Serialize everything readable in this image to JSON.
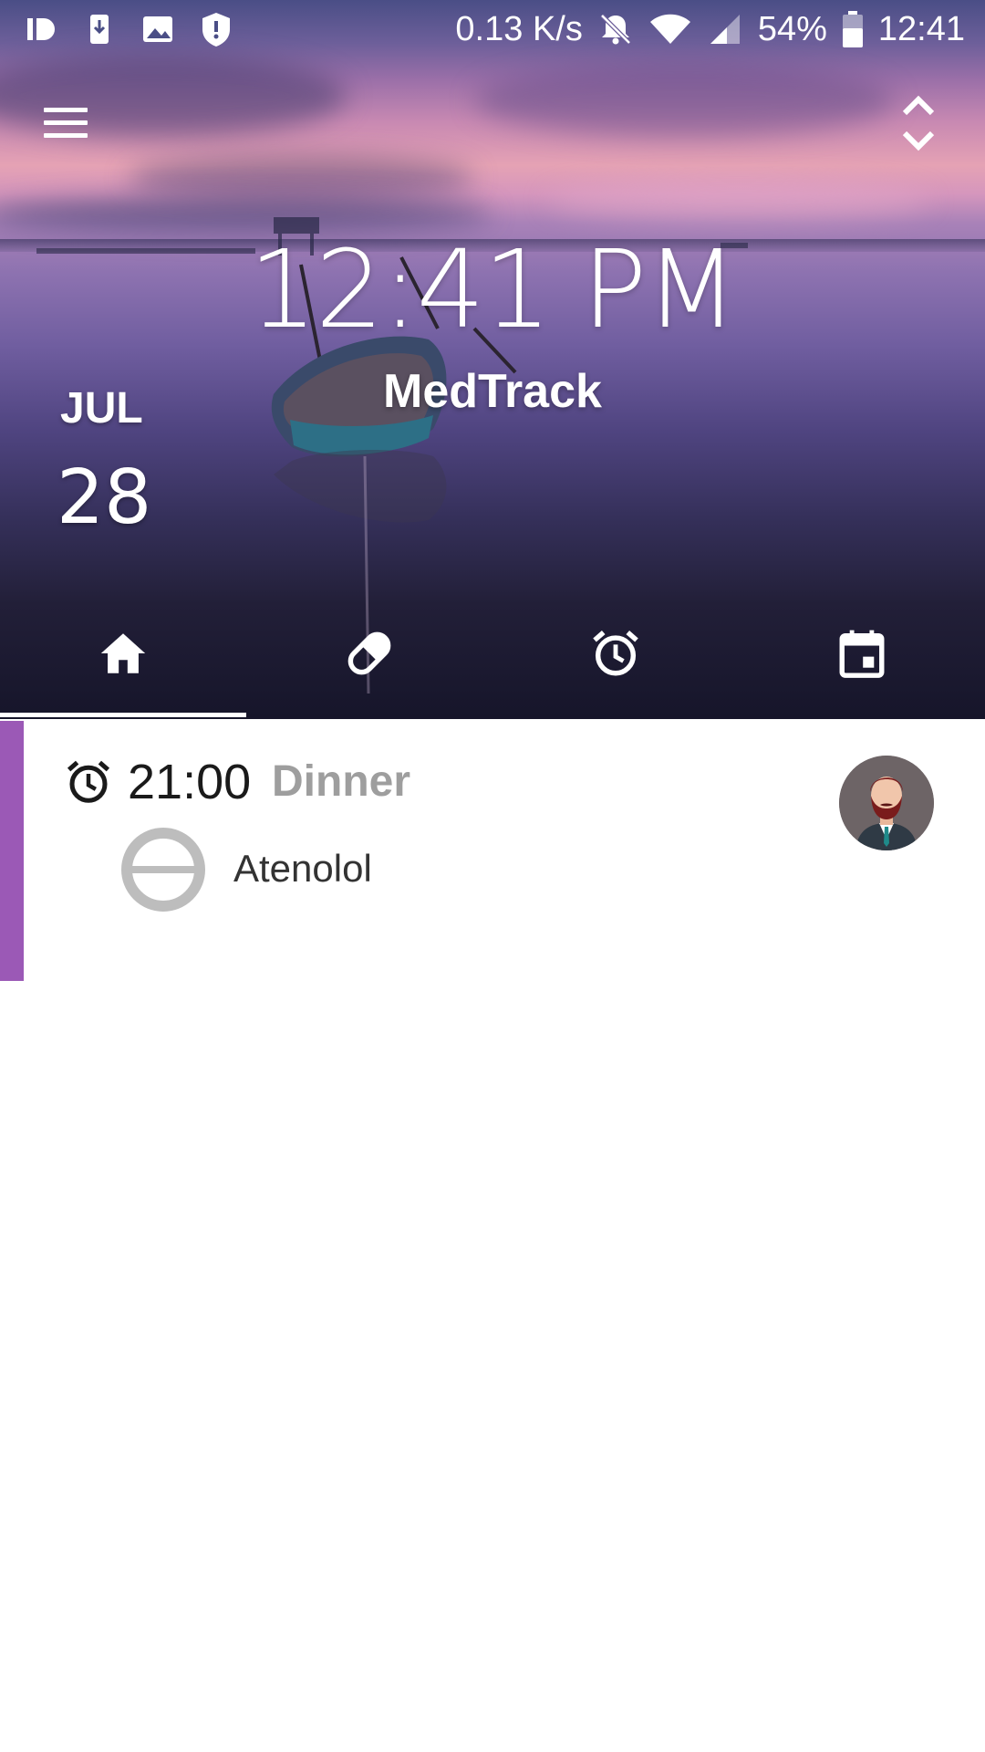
{
  "status_bar": {
    "network_speed": "0.13 K/s",
    "battery_percent": "54%",
    "time": "12:41",
    "left_icons": [
      "app-id-icon",
      "download-icon",
      "image-icon",
      "shield-icon"
    ],
    "right_icons": [
      "bell-off-icon",
      "wifi-icon",
      "signal-icon",
      "battery-icon"
    ]
  },
  "app_bar": {
    "menu_icon": "hamburger-menu-icon",
    "expand_icon": "expand-collapse-icon"
  },
  "header": {
    "time": "12:41 PM",
    "app_name": "MedTrack",
    "month": "JUL",
    "day": "28"
  },
  "tabs": [
    {
      "icon": "home-icon",
      "selected": true
    },
    {
      "icon": "pill-icon",
      "selected": false
    },
    {
      "icon": "alarm-clock-icon",
      "selected": false
    },
    {
      "icon": "calendar-icon",
      "selected": false
    }
  ],
  "schedule": [
    {
      "time": "21:00",
      "label": "Dinner",
      "accent_color": "#9b59b6",
      "medicines": [
        {
          "name": "Atenolol",
          "icon": "pill-status-icon"
        }
      ],
      "avatar": "user-avatar-icon"
    }
  ],
  "colors": {
    "accent": "#9b59b6",
    "label_gray": "#9e9e9e"
  }
}
